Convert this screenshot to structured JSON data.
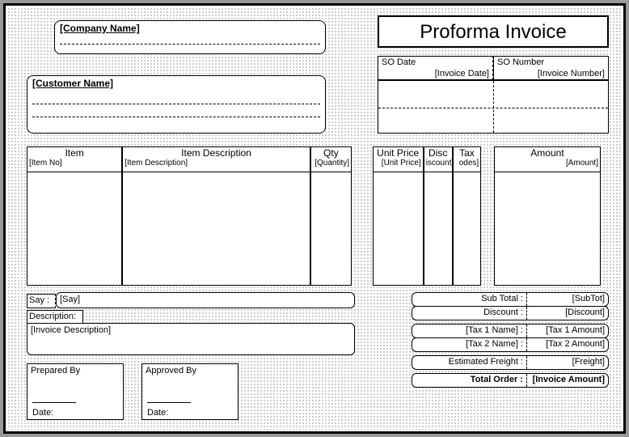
{
  "title": "Proforma Invoice",
  "company": {
    "label": "[Company Name]"
  },
  "customer": {
    "label": "[Customer Name]"
  },
  "so": {
    "date_header": "SO Date",
    "date_value": "[Invoice Date]",
    "number_header": "SO Number",
    "number_value": "[Invoice Number]"
  },
  "columns": {
    "item": {
      "header": "Item",
      "field": "[Item No]"
    },
    "desc": {
      "header": "Item Description",
      "field": "[Item Description]"
    },
    "qty": {
      "header": "Qty",
      "field": "[Quantity]"
    },
    "unit_price": {
      "header": "Unit Price",
      "field": "[Unit Price]"
    },
    "disc": {
      "header": "Disc",
      "field": "iscount]"
    },
    "tax": {
      "header": "Tax",
      "field": "odes]"
    },
    "amount": {
      "header": "Amount",
      "field": "[Amount]"
    }
  },
  "say": {
    "label": "Say :",
    "field": "[Say]"
  },
  "description": {
    "label": "Description:",
    "field": "[Invoice Description]"
  },
  "totals": {
    "subtotal_label": "Sub Total :",
    "subtotal_value": "[SubTot]",
    "discount_label": "Discount :",
    "discount_value": "[Discount]",
    "tax1_label": "[Tax 1 Name] :",
    "tax1_value": "[Tax 1 Amount]",
    "tax2_label": "[Tax 2 Name] :",
    "tax2_value": "[Tax 2 Amount]",
    "freight_label": "Estimated Freight :",
    "freight_value": "[Freight]",
    "total_label": "Total Order :",
    "total_value": "[Invoice Amount]"
  },
  "signatures": {
    "prepared": "Prepared By",
    "approved": "Approved By",
    "date": "Date:"
  }
}
